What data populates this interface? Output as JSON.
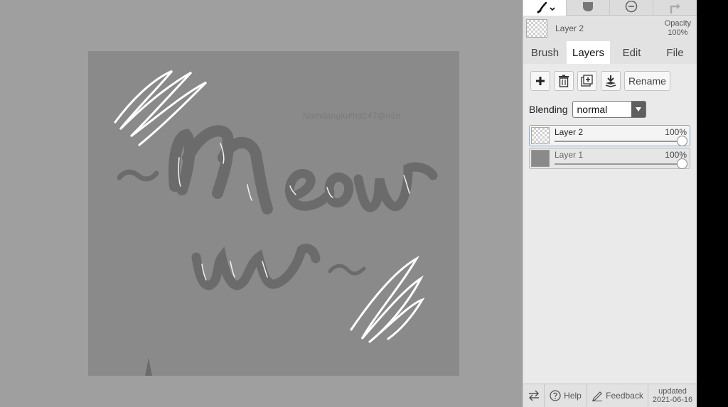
{
  "canvas": {
    "watermark": "Namdangiu#hd247@nún",
    "artwork_text": [
      "Meow",
      "ww"
    ]
  },
  "toolbar": {
    "tools": [
      "brush-icon",
      "hand-icon",
      "zoom-out-icon",
      "redo-icon"
    ]
  },
  "layerbar": {
    "current_layer": "Layer 2",
    "opacity_label": "Opacity",
    "opacity_value": "100%"
  },
  "tabs": [
    {
      "label": "Brush",
      "active": false
    },
    {
      "label": "Layers",
      "active": true
    },
    {
      "label": "Edit",
      "active": false
    },
    {
      "label": "File",
      "active": false
    }
  ],
  "layers_pane": {
    "actions": [
      "add-layer-icon",
      "delete-layer-icon",
      "duplicate-layer-icon",
      "merge-down-icon"
    ],
    "rename_label": "Rename",
    "blending_label": "Blending",
    "blending_value": "normal",
    "layers": [
      {
        "name": "Layer 2",
        "opacity": "100%",
        "opacity_fraction": 1.0,
        "selected": true
      },
      {
        "name": "Layer 1",
        "opacity": "100%",
        "opacity_fraction": 1.0,
        "selected": false
      }
    ]
  },
  "footer": {
    "help_label": "Help",
    "feedback_label": "Feedback",
    "updated_label": "updated",
    "updated_date": "2021-06-16"
  },
  "colors": {
    "workspace": "#9f9f9f",
    "canvas": "#8a8a8a",
    "panel": "#e2e2e2",
    "ink": "#6b6b6b",
    "highlight": "#ffffff"
  }
}
